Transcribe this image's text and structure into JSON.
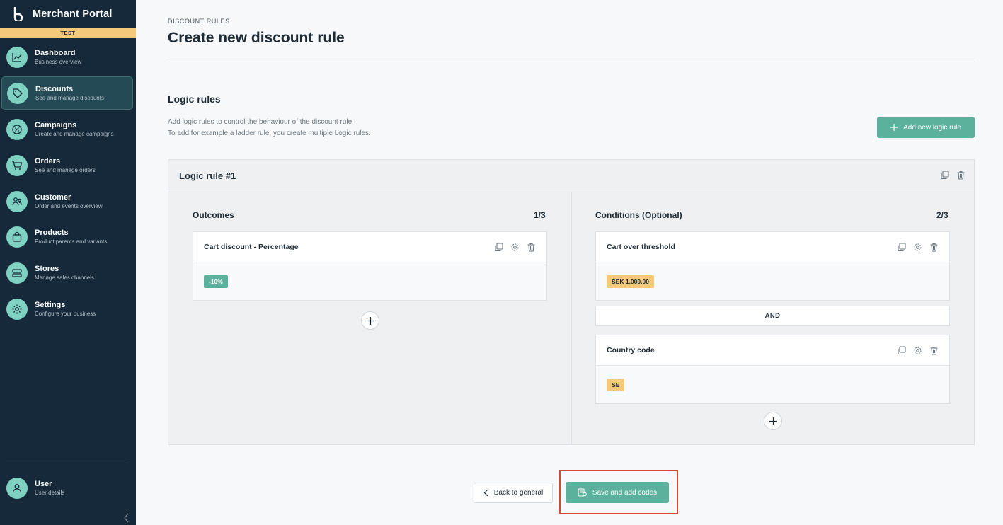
{
  "app": {
    "title": "Merchant Portal",
    "env_badge": "TEST"
  },
  "sidebar": {
    "items": [
      {
        "label": "Dashboard",
        "sub": "Business overview",
        "icon": "chart-line-icon"
      },
      {
        "label": "Discounts",
        "sub": "See and manage discounts",
        "icon": "tag-icon",
        "active": true
      },
      {
        "label": "Campaigns",
        "sub": "Create and manage campaigns",
        "icon": "percent-badge-icon"
      },
      {
        "label": "Orders",
        "sub": "See and manage orders",
        "icon": "cart-icon"
      },
      {
        "label": "Customer",
        "sub": "Order and events overview",
        "icon": "users-icon"
      },
      {
        "label": "Products",
        "sub": "Product parents and variants",
        "icon": "shopping-bag-icon"
      },
      {
        "label": "Stores",
        "sub": "Manage sales channels",
        "icon": "store-icon"
      },
      {
        "label": "Settings",
        "sub": "Configure your business",
        "icon": "gear-icon"
      }
    ],
    "user": {
      "label": "User",
      "sub": "User details",
      "icon": "user-icon"
    }
  },
  "page": {
    "eyebrow": "DISCOUNT RULES",
    "title": "Create new discount rule"
  },
  "logic": {
    "title": "Logic rules",
    "desc_line1": "Add logic rules to control the behaviour of the discount rule.",
    "desc_line2": "To add for example a ladder rule, you create multiple Logic rules.",
    "add_button": "Add new logic rule"
  },
  "rule": {
    "title": "Logic rule #1",
    "outcomes": {
      "title": "Outcomes",
      "count": "1/3",
      "items": [
        {
          "title": "Cart discount - Percentage",
          "tag": "-10%"
        }
      ]
    },
    "conditions": {
      "title": "Conditions (Optional)",
      "count": "2/3",
      "items": [
        {
          "title": "Cart over threshold",
          "tag": "SEK 1,000.00"
        },
        {
          "title": "Country code",
          "tag": "SE"
        }
      ],
      "joiner": "AND"
    }
  },
  "footer": {
    "back": "Back to general",
    "save": "Save and add codes"
  },
  "colors": {
    "sidebar_bg": "#15293a",
    "accent": "#5cb19c",
    "badge_yellow": "#f5c97a",
    "highlight": "#d9472b"
  }
}
